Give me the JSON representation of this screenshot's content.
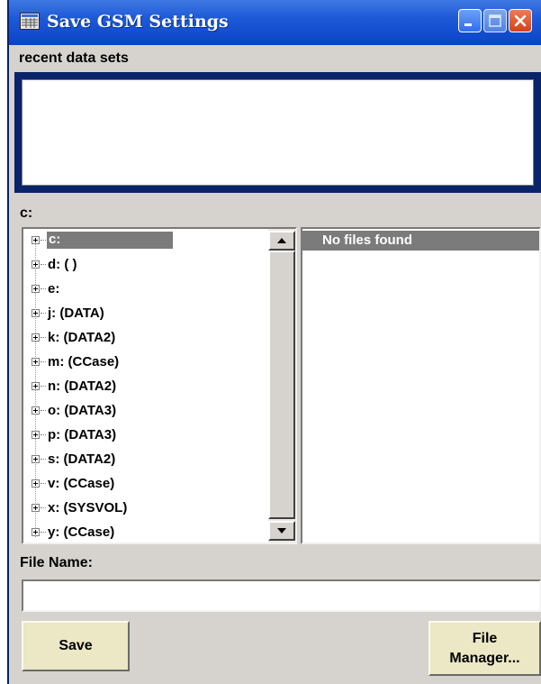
{
  "window": {
    "title": "Save GSM Settings",
    "icon": "dialog-grid-icon",
    "controls": [
      "minimize-icon",
      "maximize-icon",
      "close-icon"
    ]
  },
  "recent": {
    "label": "recent data sets",
    "items": []
  },
  "drive": {
    "current_path": "c:"
  },
  "tree": {
    "items": [
      {
        "label": "c:",
        "selected": true
      },
      {
        "label": "d: ( )"
      },
      {
        "label": "e:"
      },
      {
        "label": "j: (DATA)"
      },
      {
        "label": "k: (DATA2)"
      },
      {
        "label": "m: (CCase)"
      },
      {
        "label": "n: (DATA2)"
      },
      {
        "label": "o: (DATA3)"
      },
      {
        "label": "p: (DATA3)"
      },
      {
        "label": "s: (DATA2)"
      },
      {
        "label": "v: (CCase)"
      },
      {
        "label": "x: (SYSVOL)"
      },
      {
        "label": "y: (CCase)"
      }
    ]
  },
  "files": {
    "header": "No files found"
  },
  "filename": {
    "label": "File Name:",
    "value": ""
  },
  "buttons": {
    "save": "Save",
    "file_manager_line1": "File",
    "file_manager_line2": "Manager..."
  },
  "colors": {
    "titlebar": "#1d5ad8",
    "dialog_bg": "#d6d3ce",
    "selection": "#7b7b7b",
    "button_bg": "#ece7c4",
    "frame_dark": "#0a246a"
  }
}
